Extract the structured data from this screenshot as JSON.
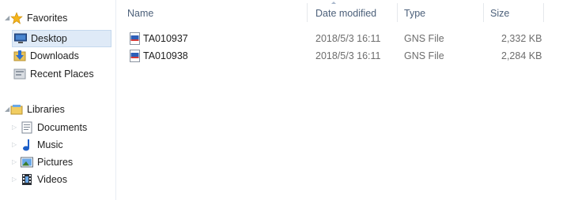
{
  "nav": {
    "favorites": {
      "label": "Favorites",
      "items": [
        {
          "label": "Desktop",
          "icon": "desktop-icon",
          "selected": true
        },
        {
          "label": "Downloads",
          "icon": "downloads-folder-icon"
        },
        {
          "label": "Recent Places",
          "icon": "recent-places-icon"
        }
      ]
    },
    "libraries": {
      "label": "Libraries",
      "items": [
        {
          "label": "Documents",
          "icon": "documents-icon"
        },
        {
          "label": "Music",
          "icon": "music-icon"
        },
        {
          "label": "Pictures",
          "icon": "pictures-icon"
        },
        {
          "label": "Videos",
          "icon": "videos-icon"
        }
      ]
    }
  },
  "columns": {
    "name": "Name",
    "date": "Date modified",
    "type": "Type",
    "size": "Size"
  },
  "files": [
    {
      "name": "TA010937",
      "date": "2018/5/3 16:11",
      "type": "GNS File",
      "size": "2,332 KB",
      "icon": "gns-file-icon"
    },
    {
      "name": "TA010938",
      "date": "2018/5/3 16:11",
      "type": "GNS File",
      "size": "2,284 KB",
      "icon": "gns-file-icon"
    }
  ],
  "colors": {
    "selection": "#dfeaf7",
    "header_text": "#4c607a",
    "meta_text": "#6d6d6d"
  }
}
